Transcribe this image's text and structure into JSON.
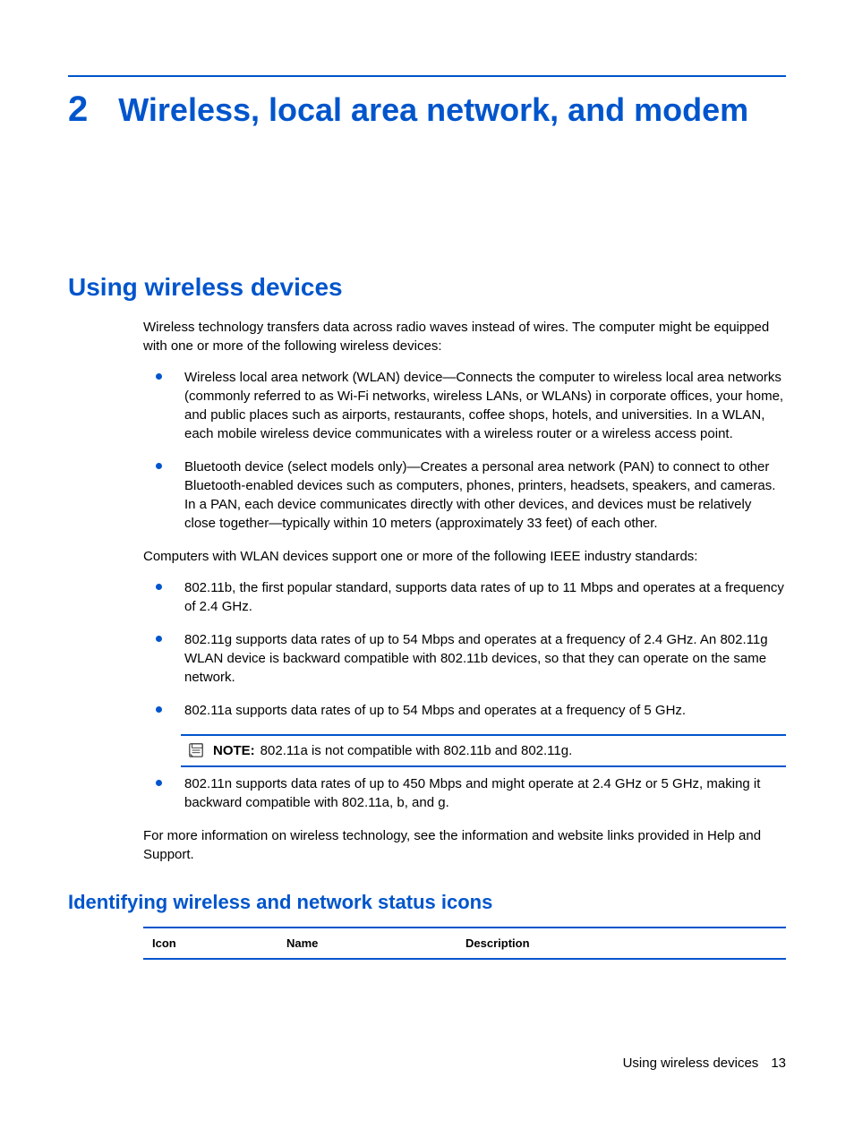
{
  "chapter": {
    "number": "2",
    "title": "Wireless, local area network, and modem"
  },
  "section": {
    "title": "Using wireless devices",
    "intro": "Wireless technology transfers data across radio waves instead of wires. The computer might be equipped with one or more of the following wireless devices:",
    "devices": [
      "Wireless local area network (WLAN) device—Connects the computer to wireless local area networks (commonly referred to as Wi-Fi networks, wireless LANs, or WLANs) in corporate offices, your home, and public places such as airports, restaurants, coffee shops, hotels, and universities. In a WLAN, each mobile wireless device communicates with a wireless router or a wireless access point.",
      "Bluetooth device (select models only)—Creates a personal area network (PAN) to connect to other Bluetooth-enabled devices such as computers, phones, printers, headsets, speakers, and cameras. In a PAN, each device communicates directly with other devices, and devices must be relatively close together—typically within 10 meters (approximately 33 feet) of each other."
    ],
    "standards_intro": "Computers with WLAN devices support one or more of the following IEEE industry standards:",
    "standards": [
      "802.11b, the first popular standard, supports data rates of up to 11 Mbps and operates at a frequency of 2.4 GHz.",
      "802.11g supports data rates of up to 54 Mbps and operates at a frequency of 2.4 GHz. An 802.11g WLAN device is backward compatible with 802.11b devices, so that they can operate on the same network.",
      "802.11a supports data rates of up to 54 Mbps and operates at a frequency of 5 GHz."
    ],
    "note_label": "NOTE:",
    "note_text": "802.11a is not compatible with 802.11b and 802.11g.",
    "standards_after_note": [
      "802.11n supports data rates of up to 450 Mbps and might operate at 2.4 GHz or 5 GHz, making it backward compatible with 802.11a, b, and g."
    ],
    "closing": "For more information on wireless technology, see the information and website links provided in Help and Support."
  },
  "subsection": {
    "title": "Identifying wireless and network status icons",
    "table": {
      "headers": {
        "icon": "Icon",
        "name": "Name",
        "desc": "Description"
      }
    }
  },
  "footer": {
    "text": "Using wireless devices",
    "page": "13"
  }
}
